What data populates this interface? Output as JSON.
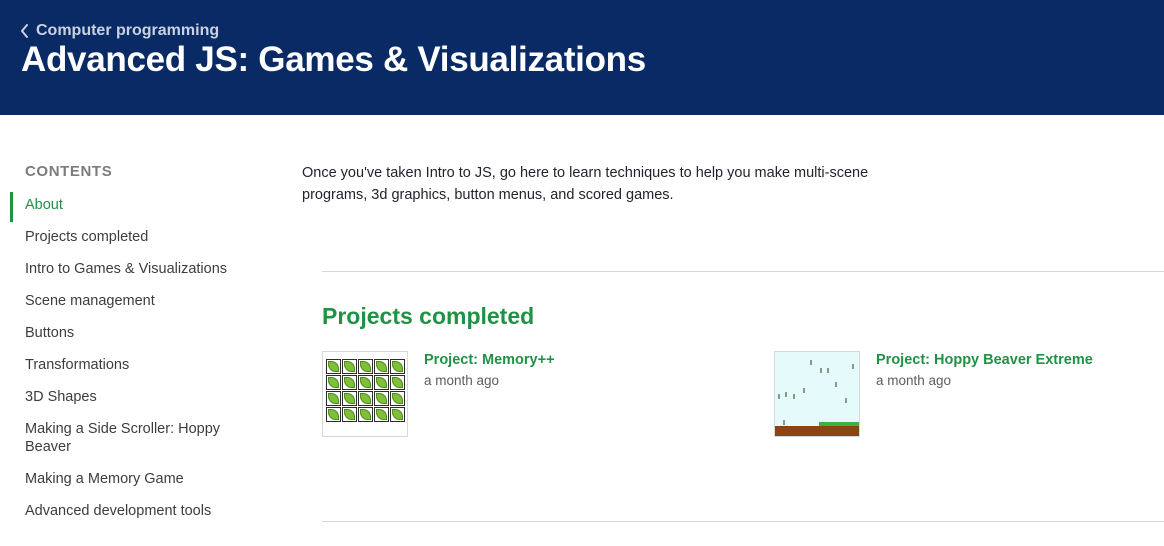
{
  "header": {
    "breadcrumb": "Computer programming",
    "title": "Advanced JS: Games & Visualizations"
  },
  "sidebar": {
    "heading": "CONTENTS",
    "items": [
      {
        "label": "About",
        "active": true
      },
      {
        "label": "Projects completed"
      },
      {
        "label": "Intro to Games & Visualizations"
      },
      {
        "label": "Scene management"
      },
      {
        "label": "Buttons"
      },
      {
        "label": "Transformations"
      },
      {
        "label": "3D Shapes"
      },
      {
        "label": "Making a Side Scroller: Hoppy Beaver"
      },
      {
        "label": "Making a Memory Game"
      },
      {
        "label": "Advanced development tools"
      }
    ]
  },
  "about": {
    "text": "Once you've taken Intro to JS, go here to learn techniques to help you make multi-scene programs, 3d graphics, button menus, and scored games."
  },
  "projects": {
    "title": "Projects completed",
    "items": [
      {
        "title": "Project: Memory++",
        "time": "a month ago"
      },
      {
        "title": "Project: Hoppy Beaver Extreme",
        "time": "a month ago"
      }
    ]
  },
  "colors": {
    "header_bg": "#0a2a66",
    "accent_green": "#1f9245"
  }
}
